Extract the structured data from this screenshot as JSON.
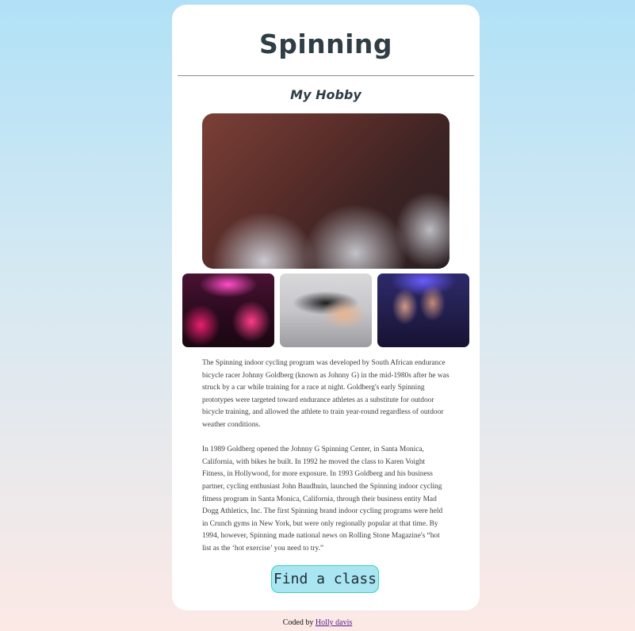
{
  "header": {
    "title": "Spinning",
    "subtitle": "My Hobby"
  },
  "images": {
    "main": "spin-class-photo",
    "thumbs": [
      "neon-spin-class-photo",
      "bike-handlebar-photo",
      "night-spin-class-photo"
    ]
  },
  "content": {
    "paragraphs": [
      "The Spinning indoor cycling program was developed by South African endurance bicycle racer Johnny Goldberg (known as Johnny G) in the mid-1980s after he was struck by a car while training for a race at night. Goldberg's early Spinning prototypes were targeted toward endurance athletes as a substitute for outdoor bicycle training, and allowed the athlete to train year-round regardless of outdoor weather conditions.",
      "In 1989 Goldberg opened the Johnny G Spinning Center, in Santa Monica, California, with bikes he built. In 1992 he moved the class to Karen Voight Fitness, in Hollywood, for more exposure. In 1993 Goldberg and his business partner, cycling enthusiast John Baudhuin, launched the Spinning indoor cycling fitness program in Santa Monica, California, through their business entity Mad Dogg Athletics, Inc. The first Spinning brand indoor cycling programs were held in Crunch gyms in New York, but were only regionally popular at that time. By 1994, however, Spinning made national news on Rolling Stone Magazine's “hot list as the ‘hot exercise’ you need to try.”"
    ]
  },
  "cta": {
    "label": "Find a class"
  },
  "footer": {
    "prefix": "Coded by",
    "author": "Holly davis"
  },
  "colors": {
    "background_top": "#b1e1f7",
    "background_bottom": "#fce9e5",
    "heading": "#2f3d45",
    "button_fill": "#a9e6f2",
    "button_border": "#33d6b4",
    "link": "#551a8b"
  }
}
